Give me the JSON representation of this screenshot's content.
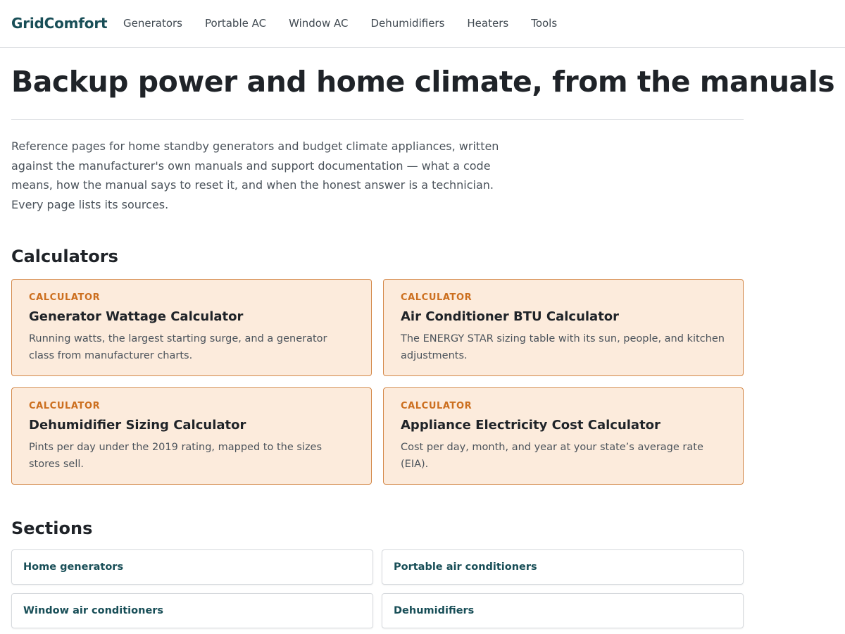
{
  "header": {
    "brand": "GridComfort",
    "nav": [
      "Generators",
      "Portable AC",
      "Window AC",
      "Dehumidifiers",
      "Heaters",
      "Tools"
    ]
  },
  "hero": {
    "title": "Backup power and home climate, from the manuals",
    "intro": "Reference pages for home standby generators and budget climate appliances, written against the manufacturer's own manuals and support documentation — what a code means, how the manual says to reset it, and when the honest answer is a technician. Every page lists its sources."
  },
  "calculators": {
    "heading": "Calculators",
    "items": [
      {
        "kicker": "CALCULATOR",
        "title": "Generator Wattage Calculator",
        "desc": "Running watts, the largest starting surge, and a generator class from manufacturer charts."
      },
      {
        "kicker": "CALCULATOR",
        "title": "Air Conditioner BTU Calculator",
        "desc": "The ENERGY STAR sizing table with its sun, people, and kitchen adjustments."
      },
      {
        "kicker": "CALCULATOR",
        "title": "Dehumidifier Sizing Calculator",
        "desc": "Pints per day under the 2019 rating, mapped to the sizes stores sell."
      },
      {
        "kicker": "CALCULATOR",
        "title": "Appliance Electricity Cost Calculator",
        "desc": "Cost per day, month, and year at your state’s average rate (EIA)."
      }
    ]
  },
  "sections": {
    "heading": "Sections",
    "items": [
      "Home generators",
      "Portable air conditioners",
      "Window air conditioners",
      "Dehumidifiers"
    ]
  },
  "colors": {
    "brand": "#184e57",
    "accent": "#cc6f1f",
    "card_bg": "#fcebdc",
    "card_border": "#d4894a"
  }
}
